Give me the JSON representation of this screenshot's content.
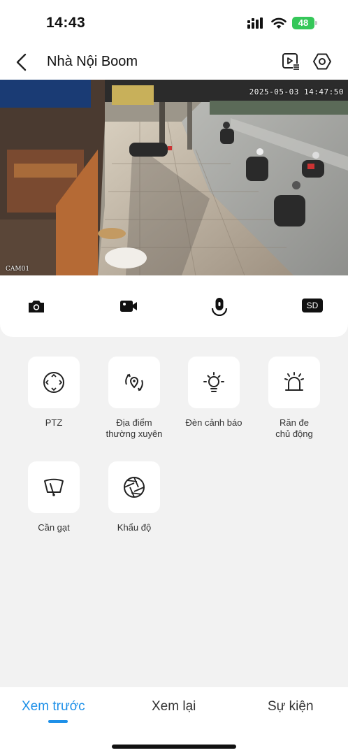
{
  "status_bar": {
    "time": "14:43",
    "battery": "48"
  },
  "header": {
    "title": "Nhà Nội Boom"
  },
  "camera": {
    "timestamp": "2025-05-03 14:47:50",
    "channel": "CAM01"
  },
  "controls": [
    "camera-icon",
    "record-icon",
    "talk-icon",
    "sd-card-icon"
  ],
  "controls_sd_label": "SD",
  "features": {
    "ptz": "PTZ",
    "places": "Địa điểm\nthường xuyên",
    "warning_light": "Đèn cảnh báo",
    "deterrence": "Răn đe\nchủ động",
    "wiper": "Cần gạt",
    "aperture": "Khẩu độ"
  },
  "tabs": {
    "preview": "Xem trước",
    "playback": "Xem lại",
    "events": "Sự kiện"
  },
  "colors": {
    "accent": "#1e90e8",
    "battery": "#35c759"
  }
}
